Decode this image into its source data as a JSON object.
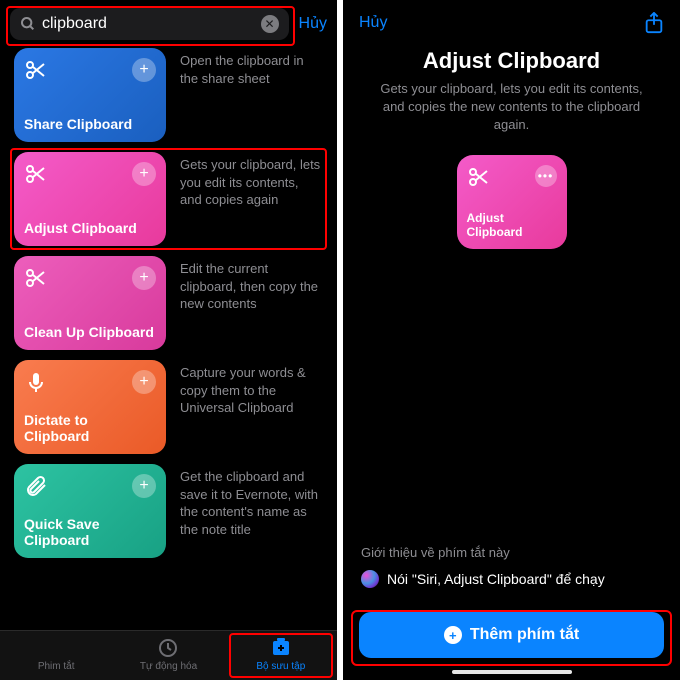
{
  "left": {
    "search": {
      "value": "clipboard",
      "placeholder": "Search"
    },
    "cancel": "Hủy",
    "results": [
      {
        "title": "Share Clipboard",
        "desc": "Open the clipboard in the share sheet",
        "icon": "scissors"
      },
      {
        "title": "Adjust Clipboard",
        "desc": "Gets your clipboard, lets you edit its contents, and copies again",
        "icon": "scissors",
        "highlighted": true
      },
      {
        "title": "Clean Up Clipboard",
        "desc": "Edit the current clipboard, then copy the new contents",
        "icon": "scissors"
      },
      {
        "title": "Dictate to Clipboard",
        "desc": "Capture your words & copy them to the Universal Clipboard",
        "icon": "mic"
      },
      {
        "title": "Quick Save Clipboard",
        "desc": "Get the clipboard and save it to Evernote, with the content's name as the note title",
        "icon": "clip"
      }
    ],
    "tabs": {
      "shortcuts": "Phim tắt",
      "automation": "Tự động hóa",
      "gallery": "Bộ sưu tập"
    }
  },
  "right": {
    "cancel": "Hủy",
    "title": "Adjust Clipboard",
    "subtitle": "Gets your clipboard, lets you edit its contents, and copies the new contents to the clipboard again.",
    "preview_title": "Adjust Clipboard",
    "intro_label": "Giới thiệu về phím tắt này",
    "siri_hint": "Nói \"Siri, Adjust Clipboard\" để chạy",
    "add_button": "Thêm phím tắt"
  }
}
